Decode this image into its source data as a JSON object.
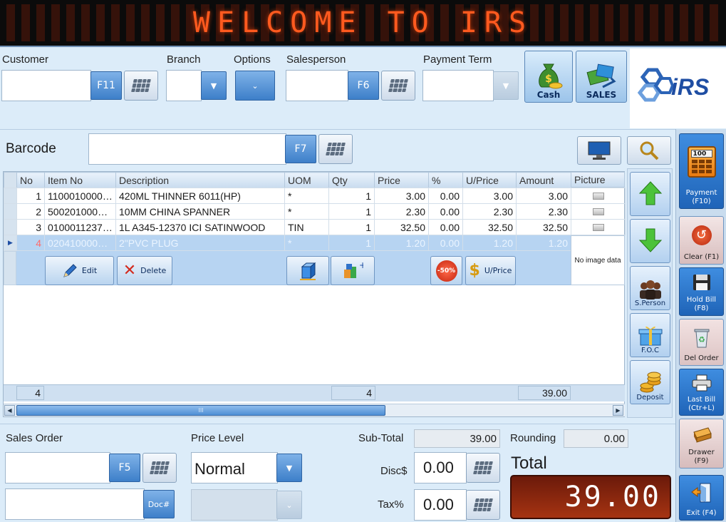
{
  "marquee": {
    "text": "WELCOME TO IRS"
  },
  "logo": {
    "text": "iRS"
  },
  "header": {
    "customer_label": "Customer",
    "customer_value": "",
    "customer_key": "F11",
    "branch_label": "Branch",
    "options_label": "Options",
    "salesperson_label": "Salesperson",
    "salesperson_value": "",
    "salesperson_key": "F6",
    "payment_term_label": "Payment Term",
    "cash_label": "Cash",
    "sales_label": "SALES"
  },
  "barcode": {
    "label": "Barcode",
    "value": "",
    "key": "F7"
  },
  "grid": {
    "columns": [
      "No",
      "Item No",
      "Description",
      "UOM",
      "Qty",
      "Price",
      "%",
      "U/Price",
      "Amount",
      "Picture"
    ],
    "rows": [
      {
        "no": "1",
        "item": "11000100000...",
        "desc": "420ML THINNER 6011(HP)",
        "uom": "*",
        "qty": "1",
        "price": "3.00",
        "pct": "0.00",
        "uprice": "3.00",
        "amount": "3.00"
      },
      {
        "no": "2",
        "item": "50020100000...",
        "desc": "10MM CHINA SPANNER",
        "uom": "*",
        "qty": "1",
        "price": "2.30",
        "pct": "0.00",
        "uprice": "2.30",
        "amount": "2.30"
      },
      {
        "no": "3",
        "item": "01000112370...",
        "desc": "1L A345-12370 ICI SATINWOOD",
        "uom": "TIN",
        "qty": "1",
        "price": "32.50",
        "pct": "0.00",
        "uprice": "32.50",
        "amount": "32.50"
      },
      {
        "no": "4",
        "item": "02041000000...",
        "desc": "2\"PVC PLUG",
        "uom": "*",
        "qty": "1",
        "price": "1.20",
        "pct": "0.00",
        "uprice": "1.20",
        "amount": "1.20"
      }
    ],
    "edit_label": "Edit",
    "delete_label": "Delete",
    "discount_badge": "-50%",
    "uprice_label": "U/Price",
    "no_image_label": "No image data",
    "footer_count": "4",
    "footer_qty": "4",
    "footer_amount": "39.00",
    "scroll_mid": "III"
  },
  "side_tools": {
    "sperson_label": "S.Person",
    "foc_label": "F.O.C",
    "deposit_label": "Deposit"
  },
  "side": {
    "payment_label": "Payment (F10)",
    "payment_badge": "100",
    "clear_label": "Clear (F1)",
    "hold_label": "Hold Bill (F8)",
    "delorder_label": "Del Order",
    "lastbill_label": "Last Bill (Ctr+L)",
    "drawer_label": "Drawer (F9)",
    "exit_label": "Exit (F4)"
  },
  "bottom": {
    "sales_order_label": "Sales Order",
    "sales_order_key": "F5",
    "doc_key": "Doc#",
    "price_level_label": "Price Level",
    "price_level_value": "Normal",
    "subtotal_label": "Sub-Total",
    "subtotal_value": "39.00",
    "rounding_label": "Rounding",
    "rounding_value": "0.00",
    "disc_label": "Disc$",
    "disc_value": "0.00",
    "tax_label": "Tax%",
    "tax_value": "0.00",
    "total_label": "Total",
    "total_value": "39.00"
  }
}
